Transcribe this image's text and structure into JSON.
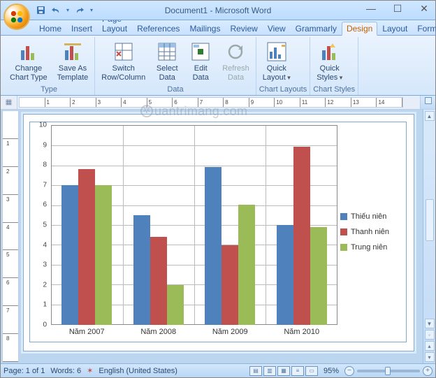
{
  "title": "Document1 - Microsoft Word",
  "qat": {
    "save": "save",
    "undo": "undo",
    "redo": "redo"
  },
  "tabs": [
    "Home",
    "Insert",
    "Page Layout",
    "References",
    "Mailings",
    "Review",
    "View",
    "Grammarly",
    "Design",
    "Layout",
    "Format"
  ],
  "active_tab": "Design",
  "ribbon": {
    "groups": [
      {
        "title": "Type",
        "buttons": [
          {
            "label": "Change\nChart Type",
            "name": "change-chart-type-button"
          },
          {
            "label": "Save As\nTemplate",
            "name": "save-as-template-button"
          }
        ]
      },
      {
        "title": "Data",
        "buttons": [
          {
            "label": "Switch\nRow/Column",
            "name": "switch-row-column-button"
          },
          {
            "label": "Select\nData",
            "name": "select-data-button"
          },
          {
            "label": "Edit\nData",
            "name": "edit-data-button"
          },
          {
            "label": "Refresh\nData",
            "name": "refresh-data-button",
            "disabled": true
          }
        ]
      },
      {
        "title": "Chart Layouts",
        "buttons": [
          {
            "label": "Quick\nLayout",
            "name": "quick-layout-button",
            "dropdown": true
          }
        ]
      },
      {
        "title": "Chart Styles",
        "buttons": [
          {
            "label": "Quick\nStyles",
            "name": "quick-styles-button",
            "dropdown": true
          }
        ]
      }
    ]
  },
  "chart_data": {
    "type": "bar",
    "categories": [
      "Năm 2007",
      "Năm 2008",
      "Năm 2009",
      "Năm 2010"
    ],
    "series": [
      {
        "name": "Thiếu niên",
        "color": "#4f81bd",
        "values": [
          7.0,
          5.5,
          7.9,
          5.0
        ]
      },
      {
        "name": "Thanh niên",
        "color": "#c0504d",
        "values": [
          7.8,
          4.4,
          4.0,
          8.9
        ]
      },
      {
        "name": "Trung niên",
        "color": "#9bbb59",
        "values": [
          7.0,
          2.0,
          6.0,
          4.9
        ]
      }
    ],
    "ylim": [
      0,
      10
    ],
    "yticks": [
      0,
      1,
      2,
      3,
      4,
      5,
      6,
      7,
      8,
      9,
      10
    ]
  },
  "ruler_labels": [
    "",
    "1",
    "2",
    "3",
    "4",
    "5",
    "6",
    "7",
    "8",
    "9",
    "10",
    "11",
    "12",
    "13",
    "14"
  ],
  "vruler_labels": [
    "",
    "1",
    "2",
    "3",
    "4",
    "5",
    "6",
    "7",
    "8"
  ],
  "status": {
    "page": "Page: 1 of 1",
    "words": "Words: 6",
    "language": "English (United States)",
    "zoom": "95%"
  },
  "watermark": "uantrimang.com"
}
